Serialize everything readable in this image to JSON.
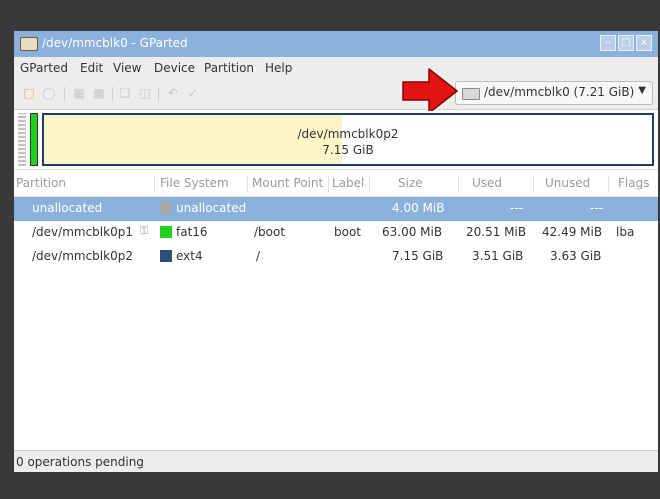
{
  "window": {
    "title": "/dev/mmcblk0 - GParted"
  },
  "menu": [
    "GParted",
    "Edit",
    "View",
    "Device",
    "Partition",
    "Help"
  ],
  "toolbar": {
    "icons": [
      "new-icon",
      "refresh-icon",
      "delete-icon",
      "resize-icon",
      "copy-icon",
      "paste-icon",
      "undo-icon",
      "apply-icon"
    ]
  },
  "device_selector": {
    "label": "/dev/mmcblk0  (7.21 GiB)"
  },
  "disk_map": {
    "main_partition_name": "/dev/mmcblk0p2",
    "main_partition_size": "7.15 GiB",
    "main_partition_used_fraction": 0.49,
    "colors": {
      "fat16": "#22d022",
      "ext4": "#2e4f75",
      "unallocated": "#a8a8a8",
      "used_fill": "#fbf5c8",
      "selection": "#8ab0dc"
    }
  },
  "table": {
    "headers": {
      "partition": "Partition",
      "file_system": "File System",
      "mount_point": "Mount Point",
      "label": "Label",
      "size": "Size",
      "used": "Used",
      "unused": "Unused",
      "flags": "Flags"
    },
    "rows": [
      {
        "partition": "unallocated",
        "fs": "unallocated",
        "fs_color": "#a8a8a8",
        "mount": "",
        "label": "",
        "size": "4.00 MiB",
        "used": "---",
        "unused": "---",
        "flags": "",
        "selected": true
      },
      {
        "partition": "/dev/mmcblk0p1",
        "fs": "fat16",
        "fs_color": "#22d022",
        "mount": "/boot",
        "label": "boot",
        "size": "63.00 MiB",
        "used": "20.51 MiB",
        "unused": "42.49 MiB",
        "flags": "lba",
        "mounted_icon": "key-icon",
        "selected": false
      },
      {
        "partition": "/dev/mmcblk0p2",
        "fs": "ext4",
        "fs_color": "#2e4f75",
        "mount": "/",
        "label": "",
        "size": "7.15 GiB",
        "used": "3.51 GiB",
        "unused": "3.63 GiB",
        "flags": "",
        "selected": false
      }
    ]
  },
  "status": {
    "text": "0 operations pending"
  }
}
